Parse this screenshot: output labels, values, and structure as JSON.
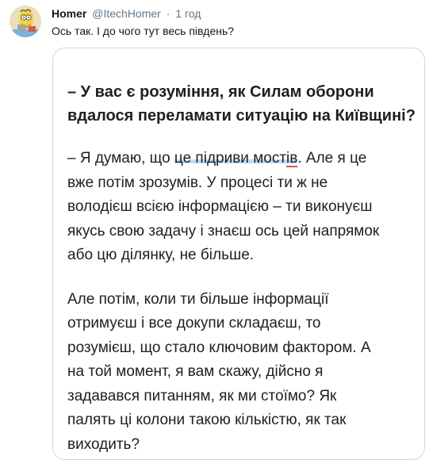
{
  "tweet": {
    "author_name": "Homer",
    "handle": "@ItechHomer",
    "separator": "·",
    "time": "1 год",
    "text": "Ось так. І до чого тут весь південь?",
    "avatar_icon": "homer-simpson-avatar"
  },
  "card": {
    "question_lines": [
      "– У вас є розуміння, як Силам оборони",
      "вдалося переламати ситуацію на Київщині?"
    ],
    "answer": {
      "line1_before": "– Я думаю, що ",
      "line1_highlight": "це підриви мост",
      "line1_underlined_end": "ів",
      "line1_after": ". Але я це",
      "lines": [
        "вже потім зрозумів. У процесі ти ж не",
        "володієш всією інформацією – ти виконуєш",
        "якусь свою задачу і знаєш ось цей напрямок",
        "або цю ділянку, не більше."
      ]
    },
    "paragraph2_lines": [
      "Але потім, коли ти більше інформації",
      "отримуєш і все докупи складаєш, то",
      "розумієш, що стало ключовим фактором. А",
      "на той момент, я вам скажу, дійсно я",
      "задавався питанням, як ми стоїмо? Як",
      "палять ці колони такою кількістю, як так",
      "виходить?"
    ]
  },
  "colors": {
    "highlight": "#b9dcfa",
    "underline": "#e0504e",
    "secondary_text": "#657786",
    "border": "#ccd6dd"
  }
}
